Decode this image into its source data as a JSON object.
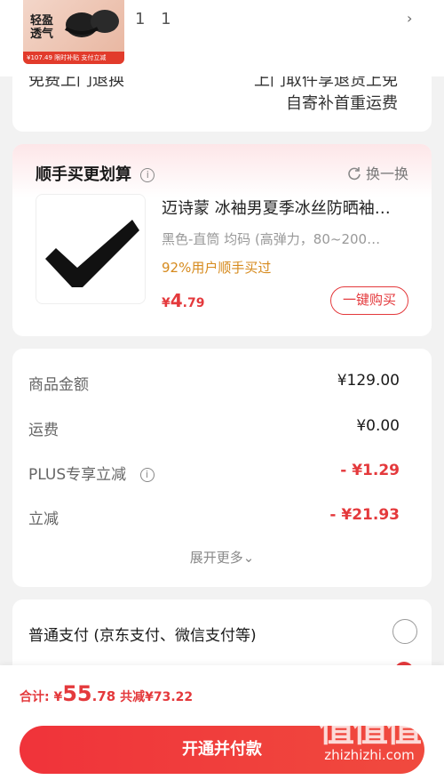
{
  "top": {
    "thumb_text": "轻盈透气",
    "thumb_bar": "¥107.49 限时补贴 支付立减",
    "count": "1 1",
    "chevron": "›"
  },
  "shipping": {
    "cut_left": "免费上门退换",
    "cut_right": "上门取件享退货上免",
    "sub": "自寄补首重运费"
  },
  "recommend": {
    "title": "顺手买更划算",
    "info_icon": "i",
    "swap_label": "换一换",
    "product_name": "迈诗蒙 冰袖男夏季冰丝防晒袖…",
    "product_spec": "黑色-直筒  均码 (高弹力，80~200…",
    "buy_percent": "92%用户顺手买过",
    "price_currency": "¥",
    "price_int": "4",
    "price_dec": ".79",
    "buy_label": "一键购买"
  },
  "summary": {
    "rows": [
      {
        "label": "商品金额",
        "value": "¥129.00"
      },
      {
        "label": "运费",
        "value": "¥0.00"
      },
      {
        "label": "PLUS专享立减",
        "value": "- ¥1.29"
      },
      {
        "label": "立减",
        "value": "- ¥21.93"
      }
    ],
    "expand_label": "展开更多⌄"
  },
  "payment": {
    "label": "普通支付 (京东支付、微信支付等)"
  },
  "footer": {
    "total_label": "合计:",
    "total_currency": "¥",
    "total_int": "55",
    "total_dec": ".78",
    "saved_label": "共减¥73.22",
    "pay_button": "开通并付款",
    "watermark_logo": "值值值",
    "watermark_url": "zhizhizhi.com"
  },
  "colors": {
    "accent_red": "#e4393c",
    "percent_orange": "#d68a1d"
  }
}
